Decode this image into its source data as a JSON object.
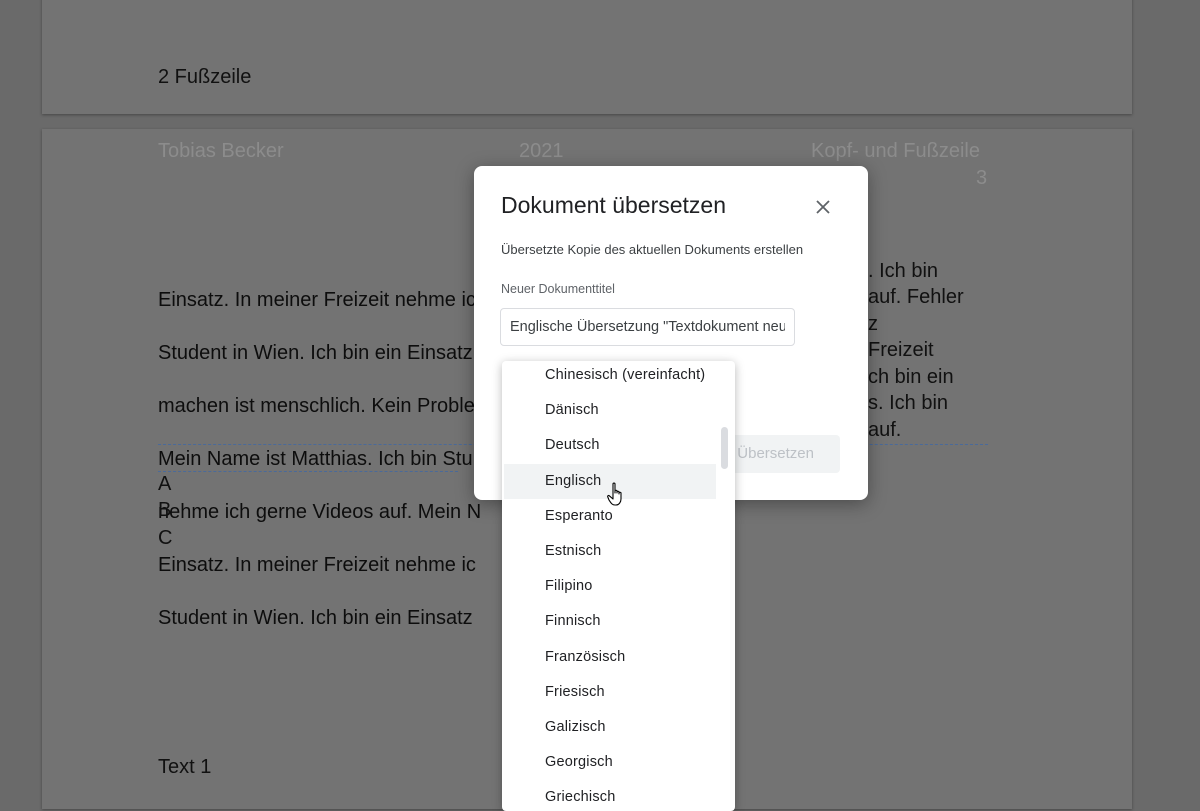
{
  "document": {
    "page1_footer": "2 Fußzeile",
    "header_left": "Tobias Becker",
    "header_center": "2021",
    "header_right": "Kopf- und Fußzeile",
    "header_page_number": "3",
    "paragraph_lines": [
      "Einsatz. In meiner Freizeit nehme ic",
      "Student in Wien. Ich bin ein Einsatz",
      "machen ist menschlich. Kein Proble",
      "Mein Name ist Matthias. Ich bin Stu",
      "nehme ich gerne Videos auf. Mein N",
      "Einsatz. In meiner Freizeit nehme ic",
      "Student in Wien. Ich bin ein Einsatz"
    ],
    "paragraph_right_fragments": [
      ". Ich bin",
      "auf. Fehler",
      "z",
      "Freizeit",
      "ch bin ein",
      "s. Ich bin",
      "auf."
    ],
    "list_items": [
      "A",
      "B",
      "C"
    ],
    "bottom_text": "Text 1"
  },
  "dialog": {
    "title": "Dokument übersetzen",
    "subtitle": "Übersetzte Kopie des aktuellen Dokuments erstellen",
    "title_label": "Neuer Dokumenttitel",
    "title_value": "Englische Übersetzung \"Textdokument neu\"",
    "translate_label": "Übersetzen",
    "close_icon": "close-icon"
  },
  "language_menu": {
    "items": [
      "Chinesisch (vereinfacht)",
      "Dänisch",
      "Deutsch",
      "Englisch",
      "Esperanto",
      "Estnisch",
      "Filipino",
      "Finnisch",
      "Französisch",
      "Friesisch",
      "Galizisch",
      "Georgisch",
      "Griechisch"
    ],
    "hovered": "Englisch"
  }
}
